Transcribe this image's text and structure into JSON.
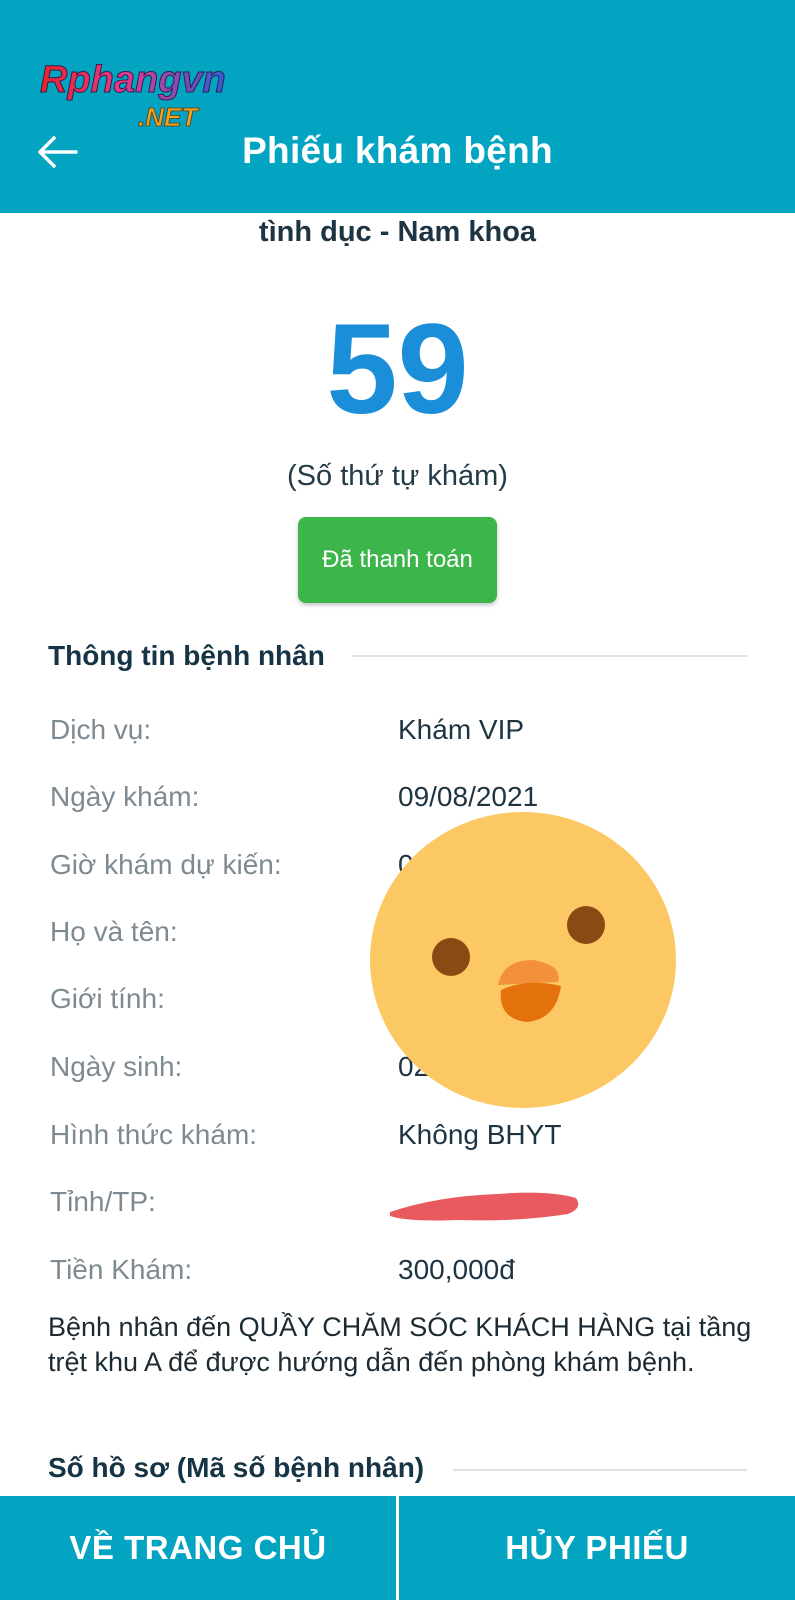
{
  "logo": {
    "line1": "Rphangvn",
    "line2": ".NET"
  },
  "header": {
    "title": "Phiếu khám bệnh",
    "back_icon": "arrow-left-icon"
  },
  "department": "tình dục - Nam khoa",
  "queue": {
    "number": "59",
    "label": "(Số thứ tự khám)"
  },
  "payment_status": "Đã thanh toán",
  "patient_section": {
    "title": "Thông tin bệnh nhân",
    "rows": [
      {
        "label": "Dịch vụ:",
        "value": "Khám VIP"
      },
      {
        "label": "Ngày khám:",
        "value": "09/08/2021"
      },
      {
        "label": "Giờ khám dự kiến:",
        "value": "0"
      },
      {
        "label": "Họ và tên:",
        "value": ""
      },
      {
        "label": "Giới tính:",
        "value": ""
      },
      {
        "label": "Ngày sinh:",
        "value": "02"
      },
      {
        "label": "Hình thức khám:",
        "value": "Không BHYT"
      },
      {
        "label": "Tỉnh/TP:",
        "value": ""
      },
      {
        "label": "Tiền Khám:",
        "value": "300,000đ"
      }
    ]
  },
  "notice": "Bệnh nhân đến QUẦY CHĂM SÓC KHÁCH HÀNG tại tầng trệt khu A để được hướng dẫn đến phòng khám bệnh.",
  "record_section": {
    "title": "Số hồ sơ (Mã số bệnh nhân)"
  },
  "bottom_nav": {
    "home_label": "VỀ TRANG CHỦ",
    "cancel_label": "HỦY PHIẾU"
  },
  "colors": {
    "primary": "#03a4c2",
    "number_blue": "#1a8ed8",
    "paid_green": "#3cb54a"
  }
}
